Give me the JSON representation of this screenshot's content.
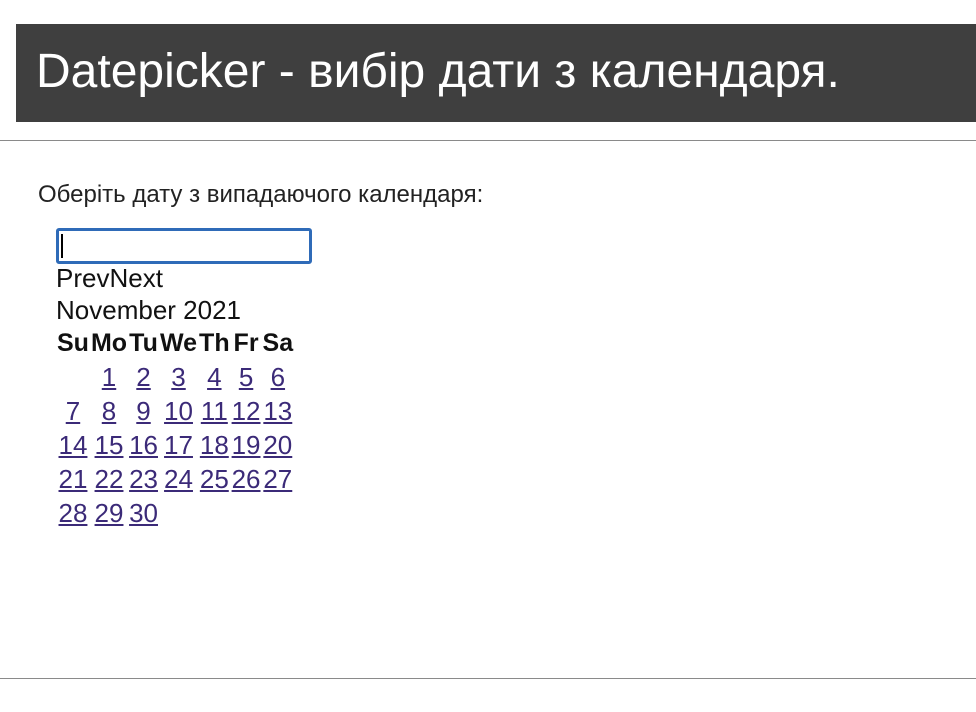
{
  "header": {
    "title": "Datepicker - вибір дати з календаря."
  },
  "prompt": "Оберіть дату з випадаючого календаря:",
  "input": {
    "value": ""
  },
  "datepicker": {
    "prev_label": "Prev",
    "next_label": "Next",
    "month_title": "November 2021",
    "weekdays": [
      "Su",
      "Mo",
      "Tu",
      "We",
      "Th",
      "Fr",
      "Sa"
    ],
    "weeks": [
      [
        "",
        "1",
        "2",
        "3",
        "4",
        "5",
        "6"
      ],
      [
        "7",
        "8",
        "9",
        "10",
        "11",
        "12",
        "13"
      ],
      [
        "14",
        "15",
        "16",
        "17",
        "18",
        "19",
        "20"
      ],
      [
        "21",
        "22",
        "23",
        "24",
        "25",
        "26",
        "27"
      ],
      [
        "28",
        "29",
        "30",
        "",
        "",
        "",
        ""
      ]
    ]
  },
  "colors": {
    "header_bg": "#3f3f3f",
    "link": "#3b2a78",
    "input_focus": "#2f6bb8"
  }
}
